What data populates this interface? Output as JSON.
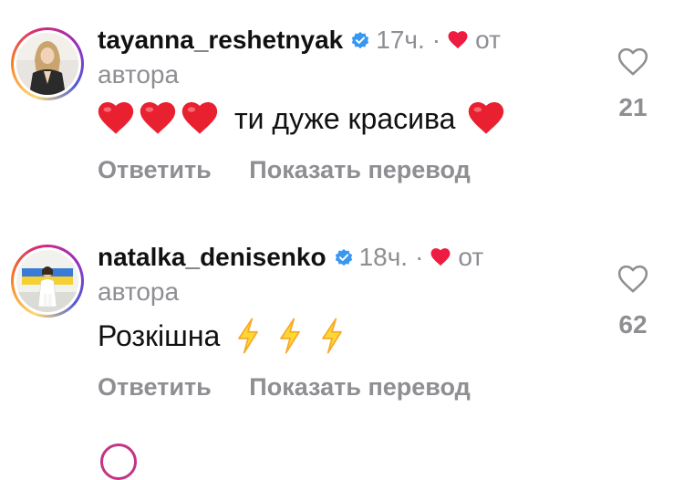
{
  "comments": [
    {
      "username": "tayanna_reshetnyak",
      "time": "17ч.",
      "from_label": "от",
      "author_label": "автора",
      "text": "ти дуже красива",
      "reply_label": "Ответить",
      "translate_label": "Показать перевод",
      "likes": "21",
      "verified": true,
      "liked_by_author": true
    },
    {
      "username": "natalka_denisenko",
      "time": "18ч.",
      "from_label": "от",
      "author_label": "автора",
      "text": "Розкішна",
      "reply_label": "Ответить",
      "translate_label": "Показать перевод",
      "likes": "62",
      "verified": true,
      "liked_by_author": true
    }
  ],
  "icons": {
    "verified": "verified-badge-icon",
    "author_heart": "heart-filled-icon",
    "like": "heart-outline-icon",
    "emoji_heart": "red-heart-emoji",
    "emoji_bolt": "high-voltage-emoji"
  },
  "colors": {
    "verified_blue": "#3897f0",
    "heart_red": "#ed1c40",
    "muted_gray": "#8e8e93",
    "bolt_yellow": "#fbc02d"
  }
}
